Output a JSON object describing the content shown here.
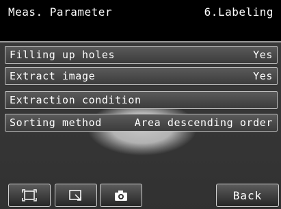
{
  "header": {
    "title": "Meas. Parameter",
    "tab": "6.Labeling"
  },
  "params": [
    {
      "label": "Filling up holes",
      "value": "Yes"
    },
    {
      "label": "Extract image",
      "value": "Yes"
    },
    {
      "label": "Extraction condition",
      "value": ""
    },
    {
      "label": "Sorting method",
      "value": "Area descending order"
    }
  ],
  "toolbar": {
    "frame_icon": "fit-frame-icon",
    "zoom_icon": "zoom-window-icon",
    "camera_icon": "camera-icon",
    "back_label": "Back"
  },
  "colors": {
    "header_bg": "#000000",
    "row_bg": "#4a4a4a",
    "border": "#bdbdbd"
  }
}
